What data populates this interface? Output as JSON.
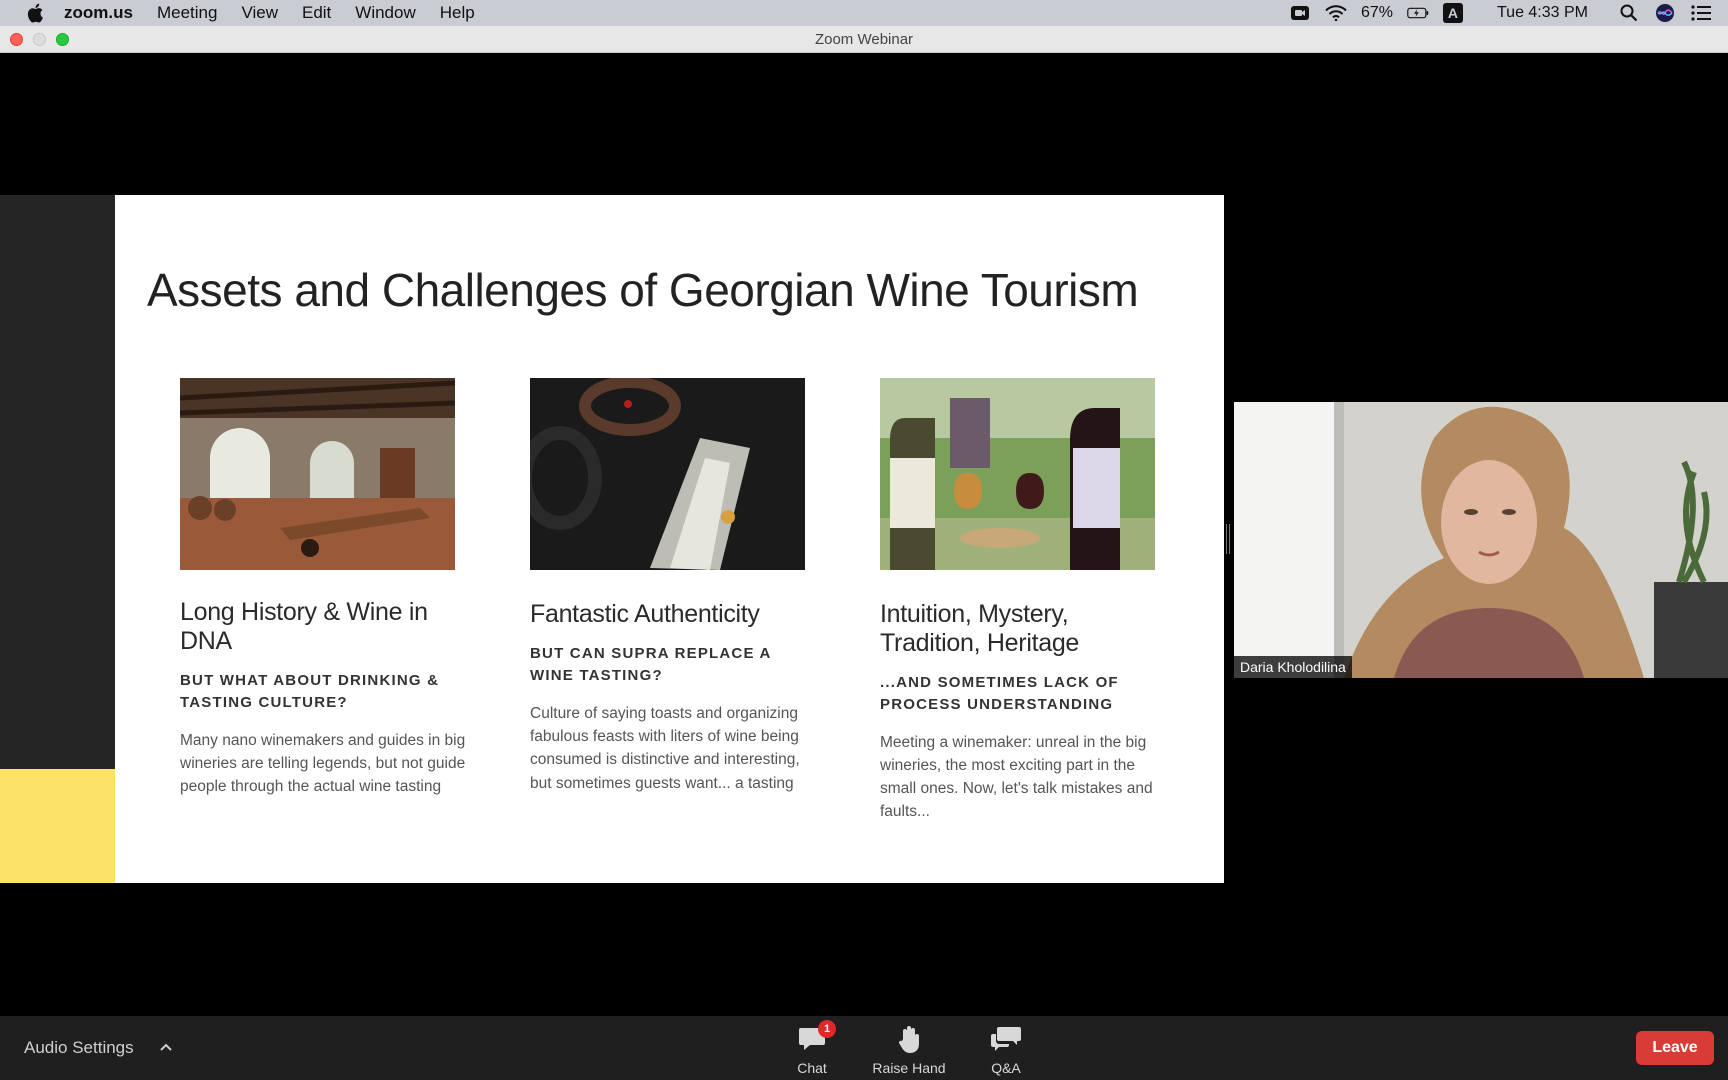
{
  "menubar": {
    "app_name": "zoom.us",
    "items": [
      "Meeting",
      "View",
      "Edit",
      "Window",
      "Help"
    ],
    "battery": "67%",
    "input_source": "A",
    "clock": "Tue 4:33 PM"
  },
  "window": {
    "title": "Zoom Webinar"
  },
  "slide": {
    "title": "Assets and Challenges of Georgian Wine Tourism",
    "columns": [
      {
        "heading": "Long History & Wine in DNA",
        "subheading": "BUT WHAT ABOUT DRINKING & TASTING CULTURE?",
        "body": "Many nano winemakers and guides in big wineries are telling legends, but not guide people through the actual wine tasting"
      },
      {
        "heading": "Fantastic Authenticity",
        "subheading": "BUT CAN SUPRA REPLACE A WINE TASTING?",
        "body": "Culture of saying toasts and organizing fabulous feasts with liters of wine being consumed is distinctive and interesting, but sometimes guests want... a tasting"
      },
      {
        "heading": "Intuition, Mystery, Tradition, Heritage",
        "subheading": "...AND SOMETIMES LACK OF PROCESS UNDERSTANDING",
        "body": "Meeting a winemaker: unreal in the big wineries, the most exciting part in the small ones. Now, let's talk mistakes and faults..."
      }
    ]
  },
  "participant": {
    "name": "Daria Kholodilina"
  },
  "toolbar": {
    "audio_settings": "Audio Settings",
    "chat": "Chat",
    "chat_badge": "1",
    "raise_hand": "Raise Hand",
    "qa": "Q&A",
    "leave": "Leave"
  },
  "colors": {
    "accent_yellow": "#fde26a",
    "leave_red": "#d93b36",
    "badge_red": "#e02828",
    "slide_bg": "#ffffff"
  }
}
